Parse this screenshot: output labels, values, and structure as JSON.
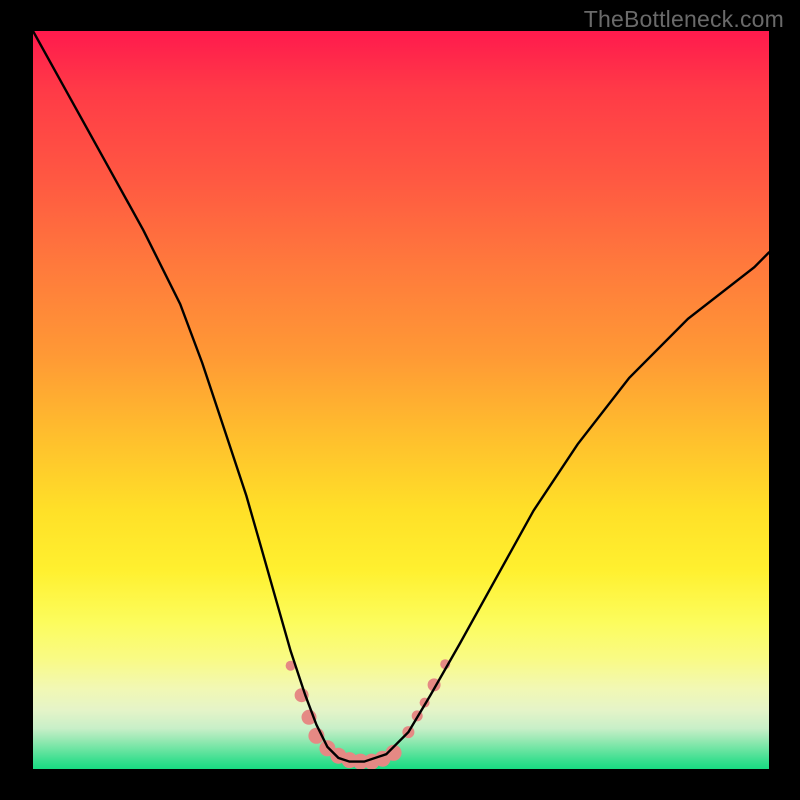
{
  "watermark": "TheBottleneck.com",
  "chart_data": {
    "type": "line",
    "title": "",
    "xlabel": "",
    "ylabel": "",
    "xlim": [
      0,
      100
    ],
    "ylim": [
      0,
      100
    ],
    "grid": false,
    "legend": false,
    "series": [
      {
        "name": "bottleneck-curve",
        "stroke": "#000000",
        "x": [
          0,
          5,
          10,
          15,
          20,
          23,
          26,
          29,
          31,
          33,
          35,
          37,
          38.5,
          40,
          41.5,
          43,
          45,
          48,
          51,
          54,
          58,
          63,
          68,
          74,
          81,
          89,
          98,
          100
        ],
        "y": [
          100,
          91,
          82,
          73,
          63,
          55,
          46,
          37,
          30,
          23,
          16,
          10,
          6,
          3,
          1.5,
          1,
          1,
          2,
          5,
          10,
          17,
          26,
          35,
          44,
          53,
          61,
          68,
          70
        ]
      }
    ],
    "markers": {
      "name": "highlight-dots",
      "color": "#e58984",
      "points": [
        {
          "x": 35.0,
          "y": 14.0,
          "r": 5
        },
        {
          "x": 36.5,
          "y": 10.0,
          "r": 7
        },
        {
          "x": 37.5,
          "y": 7.0,
          "r": 7.5
        },
        {
          "x": 38.5,
          "y": 4.5,
          "r": 8
        },
        {
          "x": 40.0,
          "y": 2.8,
          "r": 8
        },
        {
          "x": 41.5,
          "y": 1.8,
          "r": 8
        },
        {
          "x": 43.0,
          "y": 1.2,
          "r": 8
        },
        {
          "x": 44.5,
          "y": 1.0,
          "r": 8
        },
        {
          "x": 46.0,
          "y": 1.0,
          "r": 8
        },
        {
          "x": 47.5,
          "y": 1.4,
          "r": 8
        },
        {
          "x": 49.0,
          "y": 2.2,
          "r": 8
        },
        {
          "x": 51.0,
          "y": 5.0,
          "r": 6
        },
        {
          "x": 52.2,
          "y": 7.2,
          "r": 5.5
        },
        {
          "x": 53.2,
          "y": 9.0,
          "r": 5
        },
        {
          "x": 54.5,
          "y": 11.4,
          "r": 6.5
        },
        {
          "x": 56.0,
          "y": 14.2,
          "r": 5
        }
      ]
    }
  }
}
